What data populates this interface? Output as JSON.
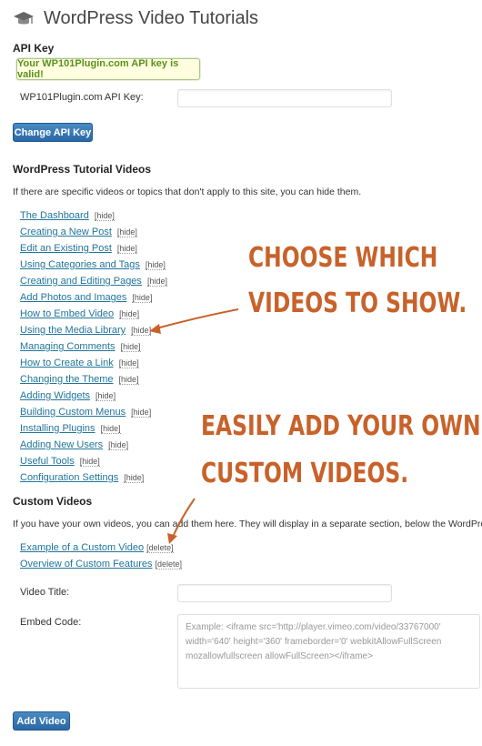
{
  "header": {
    "title": "WordPress Video Tutorials"
  },
  "api": {
    "heading": "API Key",
    "valid_notice": "Your WP101Plugin.com API key is valid!",
    "field_label": "WP101Plugin.com API Key:",
    "field_value": "",
    "button_label": "Change API Key"
  },
  "tutorials": {
    "heading": "WordPress Tutorial Videos",
    "description": "If there are specific videos or topics that don't apply to this site, you can hide them.",
    "hide_label": "[hide]",
    "items": [
      {
        "label": "The Dashboard"
      },
      {
        "label": "Creating a New Post"
      },
      {
        "label": "Edit an Existing Post"
      },
      {
        "label": "Using Categories and Tags"
      },
      {
        "label": "Creating and Editing Pages"
      },
      {
        "label": "Add Photos and Images"
      },
      {
        "label": "How to Embed Video"
      },
      {
        "label": "Using the Media Library"
      },
      {
        "label": "Managing Comments"
      },
      {
        "label": "How to Create a Link"
      },
      {
        "label": "Changing the Theme"
      },
      {
        "label": "Adding Widgets"
      },
      {
        "label": "Building Custom Menus"
      },
      {
        "label": "Installing Plugins"
      },
      {
        "label": "Adding New Users"
      },
      {
        "label": "Useful Tools"
      },
      {
        "label": "Configuration Settings"
      }
    ]
  },
  "custom": {
    "heading": "Custom Videos",
    "description": "If you have your own videos, you can add them here. They will display in a separate section, below the WordPress tutorial",
    "delete_label": "[delete]",
    "items": [
      {
        "label": "Example of a Custom Video"
      },
      {
        "label": "Overview of Custom Features"
      }
    ],
    "title_label": "Video Title:",
    "title_value": "",
    "embed_label": "Embed Code:",
    "embed_placeholder": "Example: <iframe src='http://player.vimeo.com/video/33767000' width='640' height='360' frameborder='0' webkitAllowFullScreen mozallowfullscreen allowFullScreen></iframe>",
    "add_button_label": "Add Video"
  },
  "annotations": {
    "choose_line1": "CHOOSE WHICH",
    "choose_line2": "VIDEOS TO SHOW.",
    "add_line1": "EASILY ADD YOUR OWN",
    "add_line2": "CUSTOM VIDEOS.",
    "color": "#c8622a"
  },
  "colors": {
    "link": "#21759b",
    "button": "#2a68a6",
    "notice_text": "#5b8f1c"
  }
}
